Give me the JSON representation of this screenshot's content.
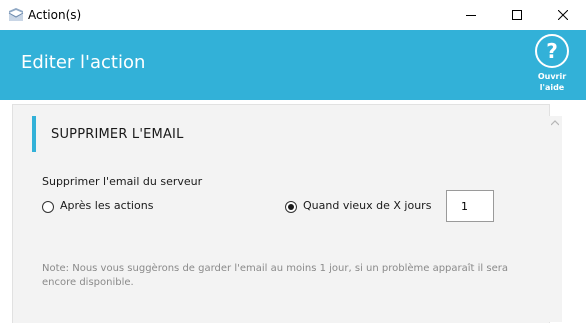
{
  "window": {
    "title": "Action(s)",
    "minimize_icon": "minimize-icon",
    "maximize_icon": "maximize-icon",
    "close_icon": "close-icon"
  },
  "header": {
    "title": "Editer l'action",
    "help_icon": "help-icon",
    "help_label_line1": "Ouvrir",
    "help_label_line2": "l'aide",
    "color": "#32b1d8"
  },
  "section": {
    "title": "SUPPRIMER L'EMAIL",
    "field_label": "Supprimer l'email du serveur",
    "options": [
      {
        "label": "Après les actions",
        "selected": false
      },
      {
        "label": "Quand vieux de X jours",
        "selected": true
      }
    ],
    "days_value": "1",
    "note": "Note: Nous vous suggèrons de garder l'email au moins 1 jour, si un problème apparaît il sera encore disponible."
  }
}
